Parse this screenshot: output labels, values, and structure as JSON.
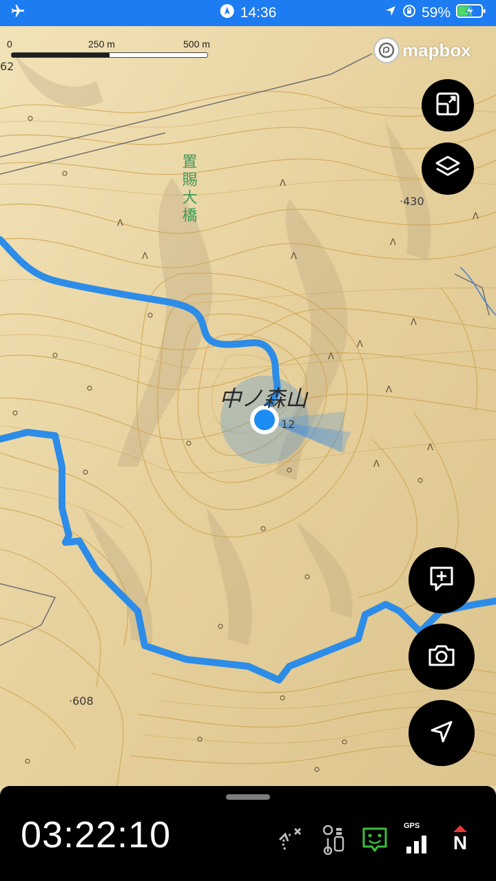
{
  "status_bar": {
    "time": "14:36",
    "battery": "59%",
    "airplane_icon": "airplane-icon",
    "location_icon": "location-arrow-icon",
    "lock_icon": "rotation-lock-icon",
    "battery_icon": "battery-charging-icon",
    "background": "#1d7cf2"
  },
  "map": {
    "scale": {
      "start": "0",
      "mid": "250 m",
      "end": "500 m",
      "filled_fraction": 0.5
    },
    "attribution": "mapbox",
    "labels": {
      "peak_name": "中ノ森山",
      "peak_elev_fragment": "12",
      "bridge_name": "置賜大橋",
      "elev_430": "·430",
      "elev_608": "·608",
      "elev_62": "62"
    },
    "route_color": "#2c8ce8",
    "user_location_color": "#1c8cf2"
  },
  "buttons": {
    "expand": "expand-icon",
    "layers": "layers-icon",
    "add_note": "add-note-icon",
    "camera": "camera-icon",
    "locate": "navigation-arrow-icon"
  },
  "bottom_bar": {
    "elapsed_time": "03:22:10",
    "gps_label": "GPS",
    "compass_label": "N",
    "icons": [
      "route-off-icon",
      "waypoints-icon",
      "face-status-icon",
      "gps-signal-icon",
      "compass-north-icon"
    ],
    "status_green": "#3bbf3b",
    "compass_red": "#e53935"
  }
}
